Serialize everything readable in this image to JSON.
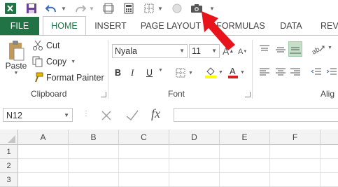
{
  "tabs": {
    "file": "FILE",
    "home": "HOME",
    "insert": "INSERT",
    "page_layout": "PAGE LAYOUT",
    "formulas": "FORMULAS",
    "data": "DATA",
    "review_partial": "REV"
  },
  "clipboard": {
    "paste": "Paste",
    "cut": "Cut",
    "copy": "Copy",
    "format_painter": "Format Painter",
    "group_label": "Clipboard"
  },
  "font": {
    "name": "Nyala",
    "size": "11",
    "bold": "B",
    "italic": "I",
    "underline": "U",
    "group_label": "Font"
  },
  "alignment": {
    "group_label_partial": "Alig"
  },
  "formula_bar": {
    "name_box": "N12",
    "fx": "fx",
    "formula": ""
  },
  "grid": {
    "columns": [
      "A",
      "B",
      "C",
      "D",
      "E",
      "F"
    ],
    "rows": [
      "1",
      "2",
      "3"
    ]
  },
  "colors": {
    "accent": "#217346",
    "arrow": "#e8141c",
    "font_color_bar": "#d42020",
    "highlight_bar": "#ffff00"
  }
}
